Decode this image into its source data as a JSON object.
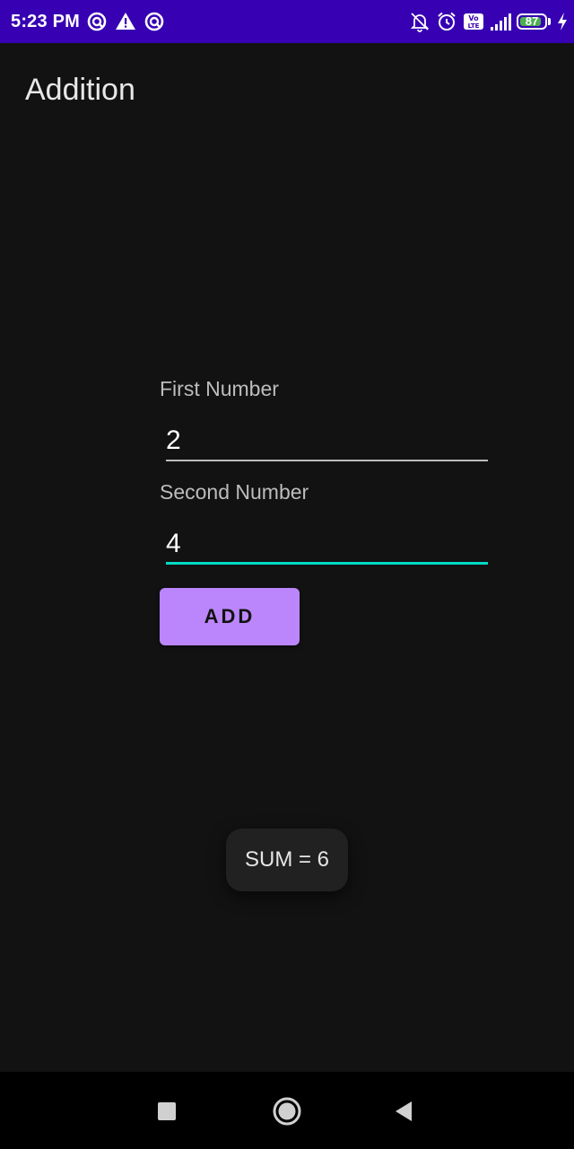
{
  "status_bar": {
    "time": "5:23 PM",
    "battery_level": "87",
    "battery_fraction": 0.87,
    "left_icons": [
      "location-target-icon",
      "warning-icon",
      "location-target-icon"
    ],
    "right_icons": [
      "alarm-off-icon",
      "alarm-clock-icon",
      "volte-icon",
      "signal-icon",
      "battery-icon",
      "charging-bolt-icon"
    ],
    "volte_label": "Vo LTE",
    "background_color": "#3700b3"
  },
  "app_bar": {
    "title": "Addition"
  },
  "form": {
    "first_label": "First Number",
    "first_value": "2",
    "second_label": "Second Number",
    "second_value": "4",
    "add_button_label": "ADD",
    "focused_field": "second"
  },
  "toast": {
    "message": "SUM = 6"
  },
  "nav_bar": {
    "buttons": [
      "recents-square-icon",
      "home-circle-icon",
      "back-triangle-icon"
    ]
  },
  "colors": {
    "background": "#121212",
    "accent": "#03dac5",
    "button": "#bb86fc",
    "battery_fill": "#4caf50"
  }
}
